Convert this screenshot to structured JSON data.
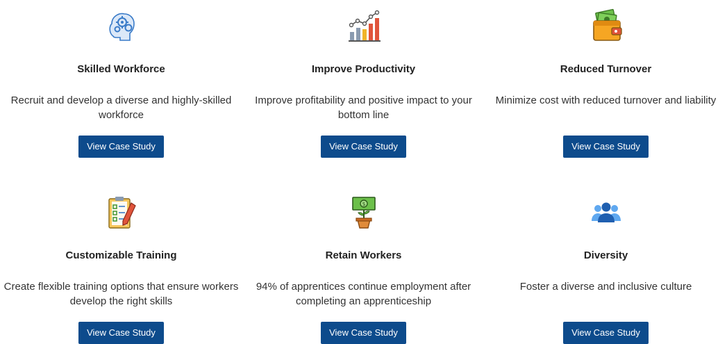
{
  "cards": [
    {
      "icon": "brain-gears-icon",
      "title": "Skilled Workforce",
      "description": "Recruit and develop a diverse and highly-skilled workforce",
      "button": "View Case Study"
    },
    {
      "icon": "bar-chart-growth-icon",
      "title": "Improve Productivity",
      "description": "Improve profitability and positive impact to your bottom line",
      "button": "View Case Study"
    },
    {
      "icon": "wallet-money-icon",
      "title": "Reduced Turnover",
      "description": "Minimize cost with reduced turnover and liability",
      "button": "View Case Study"
    },
    {
      "icon": "clipboard-checklist-icon",
      "title": "Customizable Training",
      "description": "Create flexible training options that ensure workers develop the right skills",
      "button": "View Case Study"
    },
    {
      "icon": "money-plant-icon",
      "title": "Retain Workers",
      "description": "94% of apprentices continue employment after completing an apprenticeship",
      "button": "View Case Study"
    },
    {
      "icon": "people-group-icon",
      "title": "Diversity",
      "description": "Foster a diverse and inclusive culture",
      "button": "View Case Study"
    }
  ],
  "colors": {
    "button_bg": "#0d4b8c",
    "button_text": "#ffffff",
    "text": "#333333"
  }
}
